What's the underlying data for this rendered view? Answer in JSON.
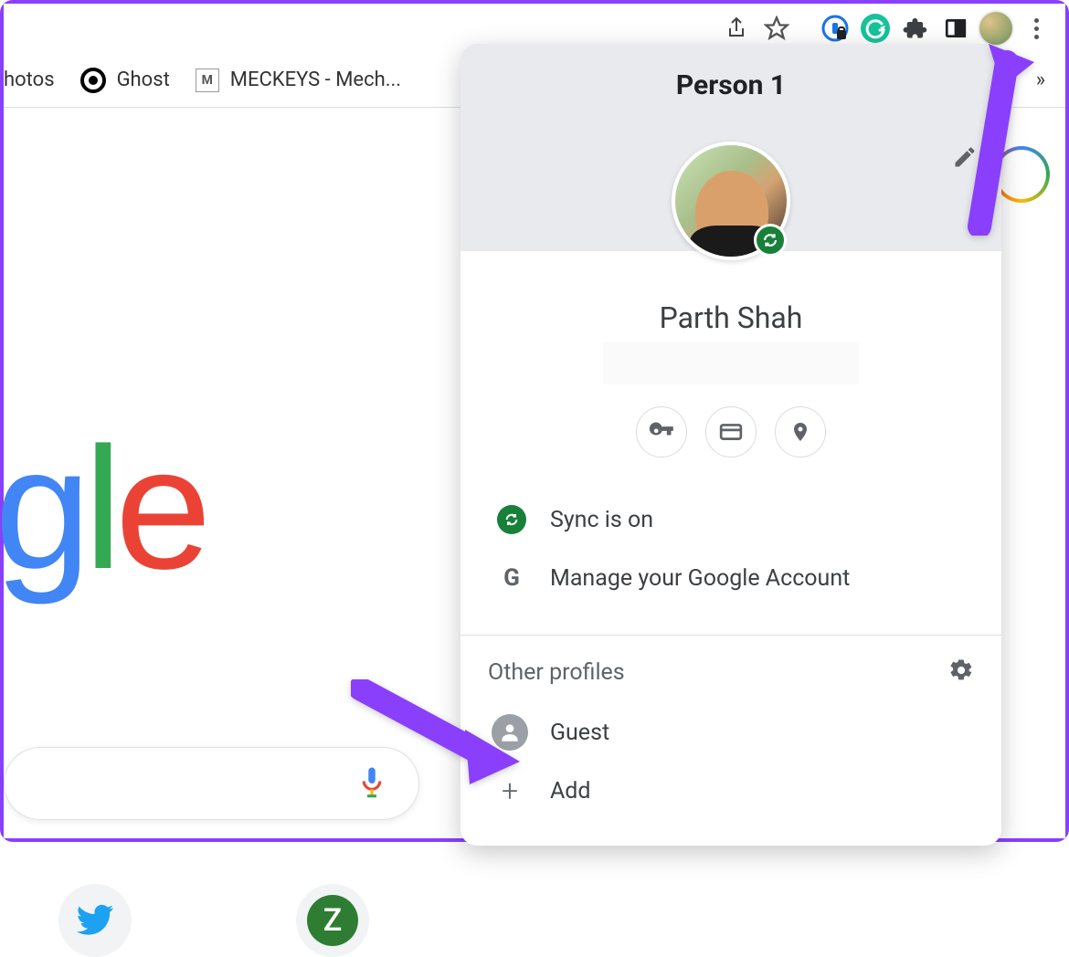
{
  "toolbar": {},
  "bookmarks": {
    "photos": "hotos",
    "ghost": "Ghost",
    "meckeys": "MECKEYS - Mech...",
    "overflow": "»"
  },
  "popup": {
    "title": "Person 1",
    "user_name": "Parth Shah",
    "sync_label": "Sync is on",
    "manage_label": "Manage your Google Account",
    "other_profiles_label": "Other profiles",
    "guest_label": "Guest",
    "add_label": "Add"
  },
  "shortcuts": {
    "z_initial": "Z"
  }
}
